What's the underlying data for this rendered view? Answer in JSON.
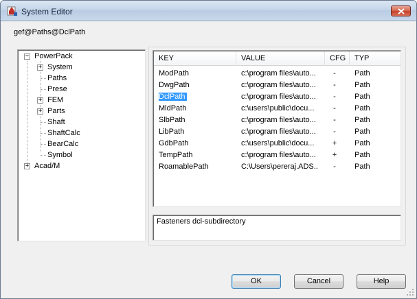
{
  "window": {
    "title": "System Editor"
  },
  "path_label": "gef@Paths@DclPath",
  "tree": {
    "items": [
      {
        "label": "PowerPack",
        "expander": "−"
      },
      {
        "label": "System",
        "expander": "+"
      },
      {
        "label": "Paths",
        "expander": ""
      },
      {
        "label": "Prese",
        "expander": ""
      },
      {
        "label": "FEM",
        "expander": "+"
      },
      {
        "label": "Parts",
        "expander": "+"
      },
      {
        "label": "Shaft",
        "expander": ""
      },
      {
        "label": "ShaftCalc",
        "expander": ""
      },
      {
        "label": "BearCalc",
        "expander": ""
      },
      {
        "label": "Symbol",
        "expander": ""
      },
      {
        "label": "Acad/M",
        "expander": "+"
      }
    ]
  },
  "list": {
    "columns": [
      "KEY",
      "VALUE",
      "CFG",
      "TYP"
    ],
    "selected_key": "DclPath",
    "rows": [
      {
        "key": "ModPath",
        "value": "c:\\program files\\auto...",
        "cfg": "-",
        "typ": "Path"
      },
      {
        "key": "DwgPath",
        "value": "c:\\program files\\auto...",
        "cfg": "-",
        "typ": "Path"
      },
      {
        "key": "DclPath",
        "value": "c:\\program files\\auto...",
        "cfg": "-",
        "typ": "Path"
      },
      {
        "key": "MldPath",
        "value": "c:\\users\\public\\docu...",
        "cfg": "-",
        "typ": "Path"
      },
      {
        "key": "SlbPath",
        "value": "c:\\program files\\auto...",
        "cfg": "-",
        "typ": "Path"
      },
      {
        "key": "LibPath",
        "value": "c:\\program files\\auto...",
        "cfg": "-",
        "typ": "Path"
      },
      {
        "key": "GdbPath",
        "value": "c:\\users\\public\\docu...",
        "cfg": "+",
        "typ": "Path"
      },
      {
        "key": "TempPath",
        "value": "c:\\program files\\auto...",
        "cfg": "+",
        "typ": "Path"
      },
      {
        "key": "RoamablePath",
        "value": "C:\\Users\\pereraj.ADS...",
        "cfg": "-",
        "typ": "Path"
      }
    ]
  },
  "description": "Fasteners dcl-subdirectory",
  "buttons": {
    "ok": "OK",
    "cancel": "Cancel",
    "help": "Help"
  },
  "colors": {
    "selection": "#3399ff",
    "close_button": "#c7412a"
  },
  "icons": {
    "app": "app-icon",
    "close": "close-icon",
    "grip": "resize-grip-icon"
  }
}
